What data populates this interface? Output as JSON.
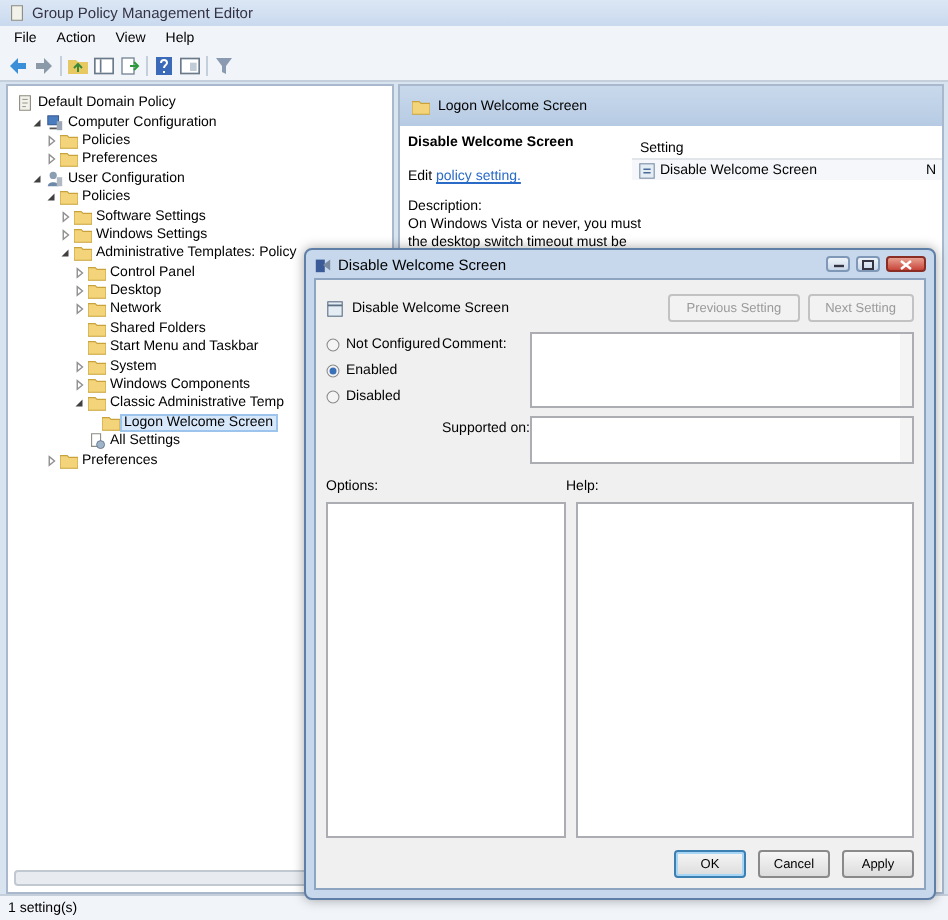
{
  "window": {
    "title": "Group Policy Management Editor"
  },
  "menu": [
    "File",
    "Action",
    "View",
    "Help"
  ],
  "tree": [
    {
      "label": "Default Domain Policy",
      "kind": "policy",
      "selected": false,
      "children": [
        {
          "label": "Computer Configuration",
          "kind": "computer",
          "selected": false,
          "expanded": true,
          "children": [
            {
              "label": "Policies",
              "kind": "folder",
              "selected": false,
              "expanded": false
            },
            {
              "label": "Preferences",
              "kind": "folder",
              "selected": false,
              "expanded": false
            }
          ]
        },
        {
          "label": "User Configuration",
          "kind": "user",
          "selected": false,
          "expanded": true,
          "children": [
            {
              "label": "Policies",
              "kind": "folder",
              "selected": false,
              "expanded": true,
              "children": [
                {
                  "label": "Software Settings",
                  "kind": "folder",
                  "selected": false,
                  "expanded": false
                },
                {
                  "label": "Windows Settings",
                  "kind": "folder",
                  "selected": false,
                  "expanded": false
                },
                {
                  "label": "Administrative Templates: Policy",
                  "kind": "folder",
                  "selected": false,
                  "expanded": true,
                  "children": [
                    {
                      "label": "Control Panel",
                      "kind": "folder",
                      "selected": false,
                      "expanded": false
                    },
                    {
                      "label": "Desktop",
                      "kind": "folder",
                      "selected": false,
                      "expanded": false
                    },
                    {
                      "label": "Network",
                      "kind": "folder",
                      "selected": false,
                      "expanded": false
                    },
                    {
                      "label": "Shared Folders",
                      "kind": "folder",
                      "selected": false
                    },
                    {
                      "label": "Start Menu and Taskbar",
                      "kind": "folder",
                      "selected": false
                    },
                    {
                      "label": "System",
                      "kind": "folder",
                      "selected": false,
                      "expanded": false
                    },
                    {
                      "label": "Windows Components",
                      "kind": "folder",
                      "selected": false,
                      "expanded": false
                    },
                    {
                      "label": "Classic Administrative Temp",
                      "kind": "folder",
                      "selected": false,
                      "expanded": true,
                      "children": [
                        {
                          "label": "Logon Welcome Screen",
                          "kind": "folder",
                          "selected": true
                        }
                      ]
                    },
                    {
                      "label": "All Settings",
                      "kind": "settings",
                      "selected": false
                    }
                  ]
                }
              ]
            },
            {
              "label": "Preferences",
              "kind": "folder",
              "selected": false,
              "expanded": false
            }
          ]
        }
      ]
    }
  ],
  "details": {
    "header": "Logon Welcome Screen",
    "policy_title": "Disable Welcome Screen",
    "edit_prefix": "Edit",
    "edit_link": "policy setting.",
    "description_label": "Description:",
    "description_lines": [
      "On Windows Vista or never, you must",
      "the desktop switch timeout must be"
    ]
  },
  "settings_table": {
    "columns": [
      "Setting"
    ],
    "rows": [
      {
        "setting": "Disable Welcome Screen",
        "column_2": "N"
      }
    ]
  },
  "status_bar": "1 setting(s)",
  "dialog": {
    "title": "Disable Welcome Screen",
    "heading": "Disable Welcome Screen",
    "nav_buttons": [
      {
        "label": "Previous Setting",
        "disabled": true
      },
      {
        "label": "Next Setting",
        "disabled": true
      }
    ],
    "choices": [
      {
        "label": "Not Configured",
        "selected": false
      },
      {
        "label": "Enabled",
        "selected": true
      },
      {
        "label": "Disabled",
        "selected": false
      }
    ],
    "comment_label": "Comment:",
    "supported_label": "Supported on:",
    "options_label": "Options:",
    "help_label": "Help:",
    "buttons": [
      {
        "label": "OK",
        "default": true
      },
      {
        "label": "Cancel",
        "default": false
      },
      {
        "label": "Apply",
        "default": false
      }
    ]
  }
}
